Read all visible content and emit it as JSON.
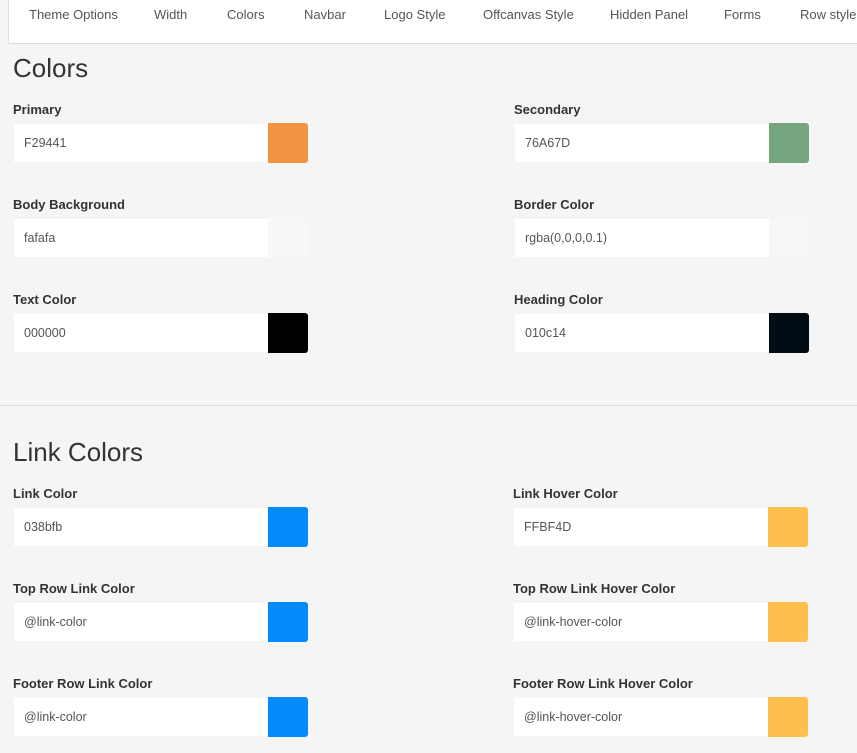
{
  "tabs": [
    "Theme Options",
    "Width",
    "Colors",
    "Navbar",
    "Logo Style",
    "Offcanvas Style",
    "Hidden Panel",
    "Forms",
    "Row style"
  ],
  "colors_section": {
    "title": "Colors",
    "fields": [
      {
        "label": "Primary",
        "value": "F29441",
        "swatch": "#F29441"
      },
      {
        "label": "Secondary",
        "value": "76A67D",
        "swatch": "#76A67D"
      },
      {
        "label": "Body Background",
        "value": "fafafa",
        "swatch": "#f7f7f7"
      },
      {
        "label": "Border Color",
        "value": "rgba(0,0,0,0.1)",
        "swatch": "#f7f7f7"
      },
      {
        "label": "Text Color",
        "value": "000000",
        "swatch": "#000000"
      },
      {
        "label": "Heading Color",
        "value": "010c14",
        "swatch": "#010c14"
      }
    ]
  },
  "link_section": {
    "title": "Link Colors",
    "fields": [
      {
        "label": "Link Color",
        "value": "038bfb",
        "swatch": "#038bfb"
      },
      {
        "label": "Link Hover Color",
        "value": "FFBF4D",
        "swatch": "#FFBF4D"
      },
      {
        "label": "Top Row Link Color",
        "value": "@link-color",
        "swatch": "#038bfb"
      },
      {
        "label": "Top Row Link Hover Color",
        "value": "@link-hover-color",
        "swatch": "#FFBF4D"
      },
      {
        "label": "Footer Row Link Color",
        "value": "@link-color",
        "swatch": "#038bfb"
      },
      {
        "label": "Footer Row Link Hover Color",
        "value": "@link-hover-color",
        "swatch": "#FFBF4D"
      }
    ]
  }
}
